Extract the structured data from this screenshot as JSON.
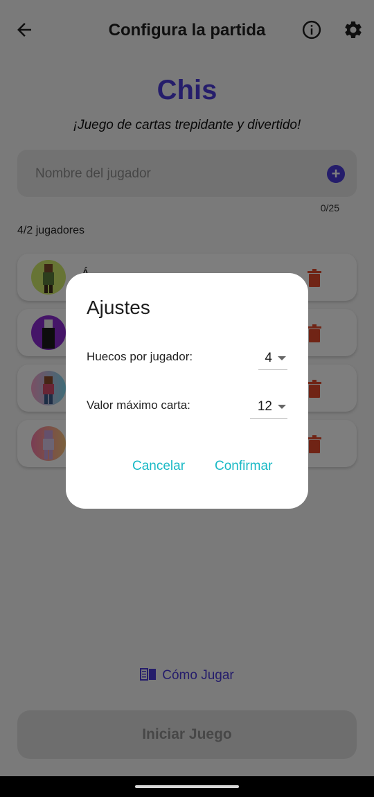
{
  "appbar": {
    "title": "Configura la partida",
    "icons": [
      "arrow-back-icon",
      "info-icon",
      "gear-icon"
    ]
  },
  "header": {
    "game_title": "Chis",
    "subtitle": "¡Juego de cartas trepidante y divertido!"
  },
  "name_input": {
    "placeholder": "Nombre del jugador",
    "value": "",
    "counter": "0/25"
  },
  "players_count": "4/2 jugadores",
  "players": [
    {
      "name": "Á..."
    },
    {
      "name": ""
    },
    {
      "name": ""
    },
    {
      "name": ""
    }
  ],
  "dialog": {
    "title": "Ajustes",
    "holes_label": "Huecos por jugador:",
    "holes_value": "4",
    "max_card_label": "Valor máximo carta:",
    "max_card_value": "12",
    "cancel": "Cancelar",
    "confirm": "Confirmar"
  },
  "footer": {
    "how_to_play": "Cómo Jugar",
    "start_game": "Iniciar Juego"
  },
  "colors": {
    "accent": "#4b3bd6",
    "dialog_button": "#19b9c5",
    "delete": "#e0492b"
  }
}
